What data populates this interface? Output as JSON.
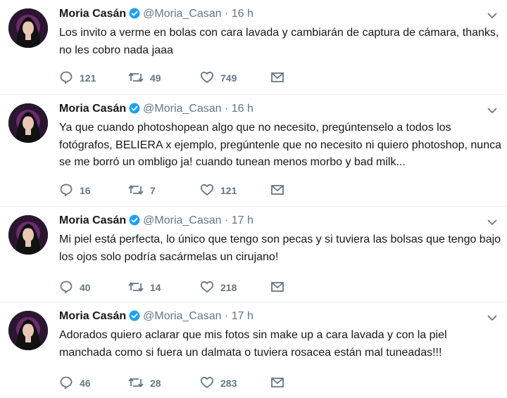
{
  "tweets": [
    {
      "name": "Moria Casán",
      "handle": "@Moria_Casan",
      "time": "16 h",
      "text": "Los invito a verme en bolas con cara lavada y cambiarán de captura de cámara, thanks, no les cobro nada jaaa",
      "replies": "121",
      "retweets": "49",
      "likes": "749"
    },
    {
      "name": "Moria Casán",
      "handle": "@Moria_Casan",
      "time": "16 h",
      "text": "Ya que cuando photoshopean algo que no necesito, pregúntenselo a todos los fotógrafos, BELIERA x ejemplo, pregúntenle que no necesito ni quiero photoshop, nunca se me borró un ombligo ja! cuando tunean menos morbo y bad milk...",
      "replies": "16",
      "retweets": "7",
      "likes": "121"
    },
    {
      "name": "Moria Casán",
      "handle": "@Moria_Casan",
      "time": "17 h",
      "text": "Mi piel está perfecta, lo único que tengo son pecas y si tuviera las bolsas que tengo bajo los ojos solo podría sacármelas un cirujano!",
      "replies": "40",
      "retweets": "14",
      "likes": "218"
    },
    {
      "name": "Moria Casán",
      "handle": "@Moria_Casan",
      "time": "17 h",
      "text": "Adorados quiero aclarar que mis fotos sin make up a cara lavada y con la piel manchada como si fuera un dalmata o tuviera rosacea están mal tuneadas!!!",
      "replies": "46",
      "retweets": "28",
      "likes": "283"
    }
  ],
  "icons": {
    "reply": "reply-icon",
    "retweet": "retweet-icon",
    "like": "heart-icon",
    "message": "envelope-icon",
    "verified": "verified-badge-icon",
    "more": "chevron-down-icon"
  },
  "colors": {
    "verified": "#1da1f2",
    "meta": "#657786",
    "divider": "#e6ecf0"
  }
}
